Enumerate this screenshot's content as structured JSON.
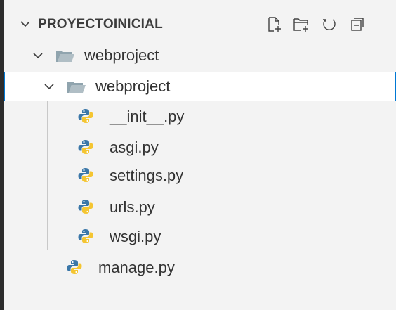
{
  "explorer": {
    "section_title": "PROYECTOINICIAL",
    "actions": [
      {
        "name": "new-file-icon"
      },
      {
        "name": "new-folder-icon"
      },
      {
        "name": "refresh-icon"
      },
      {
        "name": "collapse-all-icon"
      }
    ],
    "tree": {
      "root_folder": "webproject",
      "sub_folder": "webproject",
      "files": [
        "__init__.py",
        "asgi.py",
        "settings.py",
        "urls.py",
        "wsgi.py"
      ],
      "root_file": "manage.py"
    }
  },
  "colors": {
    "selection_border": "#0078d4",
    "folder": "#90a4ae",
    "python_blue": "#3b77a8",
    "python_yellow": "#f4c531"
  }
}
